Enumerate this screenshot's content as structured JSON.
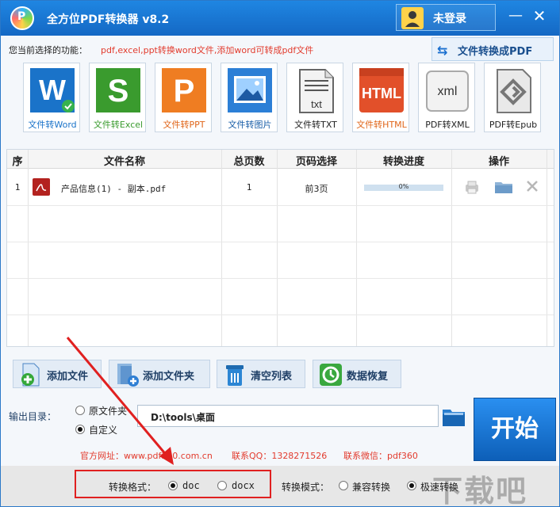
{
  "window": {
    "title": "全方位PDF转换器 v8.2",
    "login_label": "未登录",
    "minimize": "—",
    "close": "✕"
  },
  "function_line": {
    "label": "您当前选择的功能：",
    "description": "pdf,excel,ppt转换word文件,添加word可转成pdf文件",
    "to_pdf_label": "文件转换成PDF"
  },
  "tools": [
    {
      "label": "文件转Word",
      "color": "#1a73c9",
      "label_color": "#1a73c9",
      "icon": "word-icon"
    },
    {
      "label": "文件转Excel",
      "color": "#3a9b2e",
      "label_color": "#3a9b2e",
      "icon": "excel-icon"
    },
    {
      "label": "文件转PPT",
      "color": "#ef7d22",
      "label_color": "#e0661a",
      "icon": "ppt-icon"
    },
    {
      "label": "文件转图片",
      "color": "#2c7fd6",
      "label_color": "#1a5fa8",
      "icon": "image-icon"
    },
    {
      "label": "文件转TXT",
      "color": "#555555",
      "label_color": "#222222",
      "icon": "txt-icon"
    },
    {
      "label": "文件转HTML",
      "color": "#e2502a",
      "label_color": "#e0661a",
      "icon": "html-icon"
    },
    {
      "label": "PDF转XML",
      "color": "#888888",
      "label_color": "#222222",
      "icon": "xml-icon"
    },
    {
      "label": "PDF转Epub",
      "color": "#777777",
      "label_color": "#222222",
      "icon": "epub-icon"
    }
  ],
  "table": {
    "headers": [
      "序",
      "文件名称",
      "总页数",
      "页码选择",
      "转换进度",
      "操作"
    ],
    "rows": [
      {
        "index": "1",
        "name": "产品信息(1) - 副本.pdf",
        "pages": "1",
        "page_select": "前3页",
        "progress_text": "0%",
        "progress": 0
      }
    ]
  },
  "actions": [
    {
      "label": "添加文件",
      "icon": "add-file-icon"
    },
    {
      "label": "添加文件夹",
      "icon": "add-folder-icon"
    },
    {
      "label": "清空列表",
      "icon": "trash-icon"
    },
    {
      "label": "数据恢复",
      "icon": "restore-icon"
    }
  ],
  "output": {
    "label": "输出目录：",
    "option_source": "原文件夹",
    "option_custom": "自定义",
    "selected": "自定义",
    "path": "D:\\tools\\桌面",
    "start_label": "开始"
  },
  "links": {
    "website": "官方网址：www.pdf360.com.cn",
    "qq": "联系QQ：1328271526",
    "wechat": "联系微信：pdf360"
  },
  "format": {
    "label": "转换格式：",
    "option_doc": "doc",
    "option_docx": "docx",
    "selected": "doc"
  },
  "mode": {
    "label": "转换模式：",
    "option_compatible": "兼容转换",
    "option_fast": "极速转换",
    "selected": "极速转换"
  },
  "watermark": "下载吧"
}
